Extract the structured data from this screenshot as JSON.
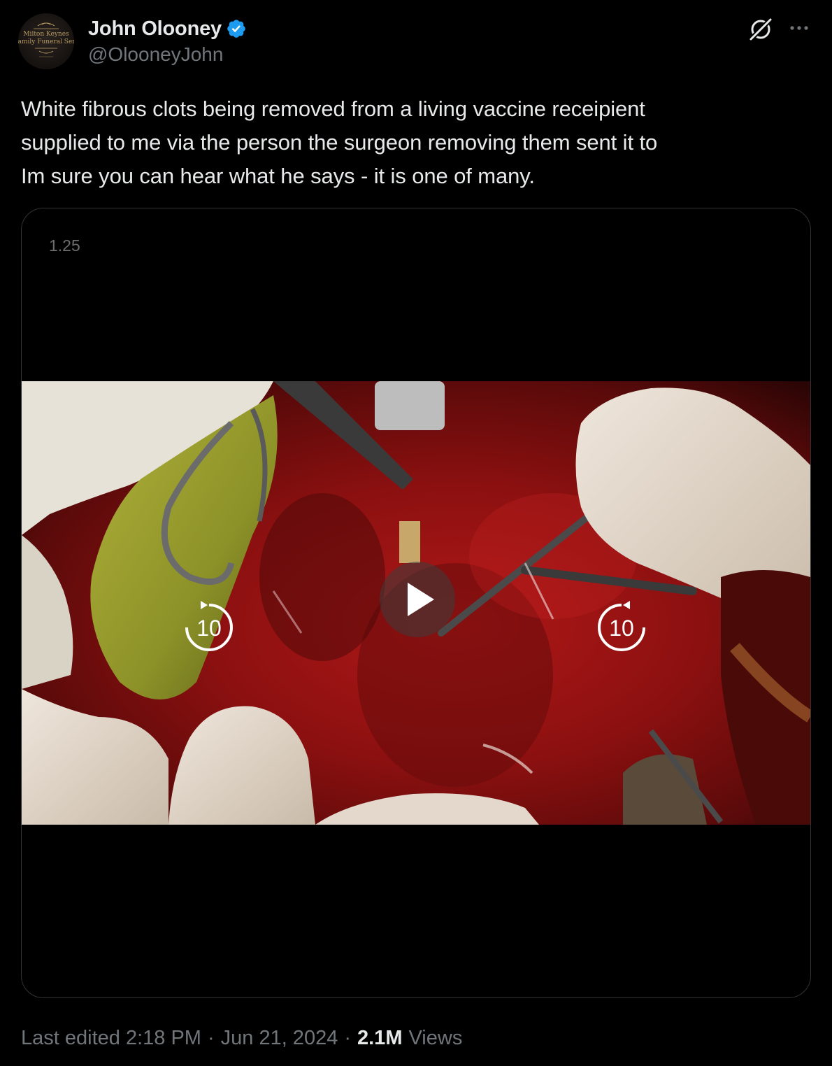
{
  "author": {
    "display_name": "John Olooney",
    "handle": "@OlooneyJohn",
    "avatar_text_line1": "Milton Keynes",
    "avatar_text_line2": "Family Funeral Servi",
    "verified": true
  },
  "tweet": {
    "lines": [
      "White fibrous clots being removed from a living vaccine receipient",
      "supplied to me via the person the surgeon removing them sent it to",
      "Im sure you can hear what he says - it is one of many."
    ]
  },
  "media": {
    "speed_label": "1.25",
    "rewind_label": "10",
    "forward_label": "10",
    "controls": [
      "rewind-10-icon",
      "play-icon",
      "forward-10-icon"
    ]
  },
  "meta": {
    "edited_text": "Last edited 2:18 PM",
    "separator": "·",
    "date": "Jun 21, 2024",
    "views_count": "2.1M",
    "views_label": "Views"
  },
  "icons": {
    "verified": "verified-badge-icon",
    "grok": "grok-icon",
    "more": "more-icon"
  },
  "colors": {
    "background": "#000000",
    "text_primary": "#e7e9ea",
    "text_secondary": "#71767b",
    "verified_blue": "#1d9bf0",
    "border": "#2f3336"
  }
}
